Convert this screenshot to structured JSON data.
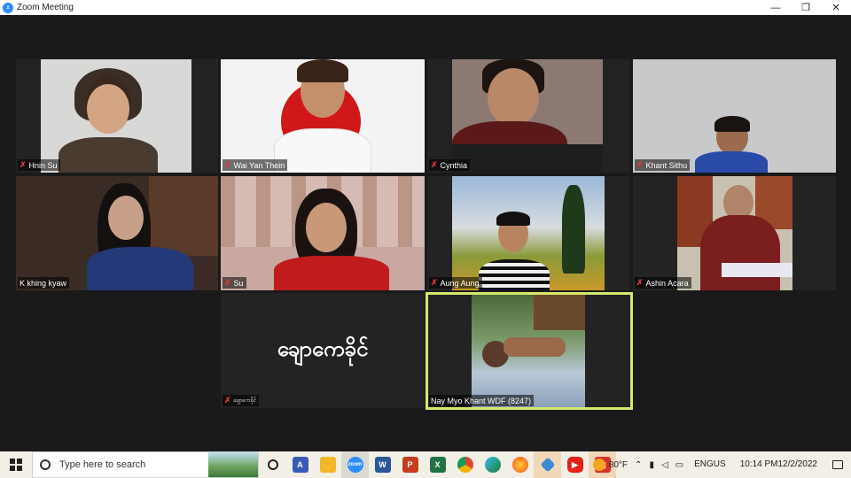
{
  "window": {
    "title": "Zoom Meeting",
    "controls": {
      "minimize": "—",
      "maximize": "❐",
      "close": "✕"
    }
  },
  "participants": [
    {
      "name": "Hnin Su",
      "muted": true
    },
    {
      "name": "Wai Yan Thein",
      "muted": true
    },
    {
      "name": "Cynthia",
      "muted": true
    },
    {
      "name": "Khant Sithu",
      "muted": true
    },
    {
      "name": "K khing kyaw",
      "muted": false
    },
    {
      "name": "Su",
      "muted": true
    },
    {
      "name": "Aung Aung",
      "muted": true
    },
    {
      "name": "Ashin Acara",
      "muted": true
    },
    {
      "name": "ချောကေခိုင်",
      "muted": true,
      "display_name_large": "ချောကေခိုင်"
    },
    {
      "name": "Nay Myo Khant WDF (8247)",
      "muted": false,
      "active_speaker": true
    }
  ],
  "taskbar": {
    "search_placeholder": "Type here to search",
    "apps": [
      "cortana-icon",
      "azure-icon",
      "file-explorer-icon",
      "zoom-icon",
      "word-icon",
      "powerpoint-icon",
      "excel-icon",
      "chrome-icon",
      "edge-icon",
      "firefox-icon",
      "pin-app-icon",
      "youtube-icon",
      "media-app-icon"
    ],
    "weather": "80°F",
    "language_line1": "ENG",
    "language_line2": "US",
    "time": "10:14 PM",
    "date": "12/2/2022"
  },
  "colors": {
    "active_speaker_border": "#d6e86b",
    "muted_icon": "#e0383b",
    "zoom_blue": "#2d8cff",
    "background": "#1a1a1a"
  }
}
